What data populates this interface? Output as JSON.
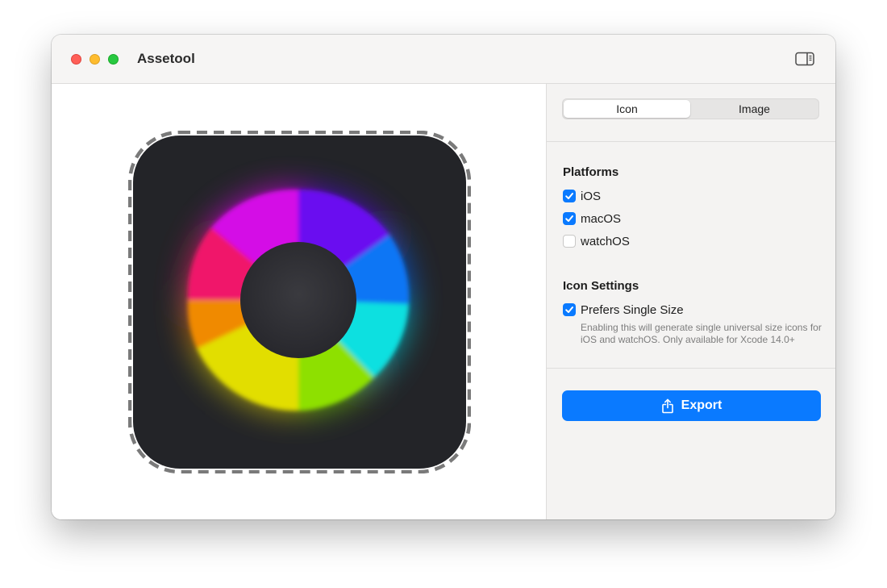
{
  "window": {
    "title": "Assetool"
  },
  "titlebar": {
    "buttons": [
      "close",
      "minimize",
      "zoom"
    ],
    "sidebar_toggle_icon": "sidebar-right-icon"
  },
  "preview": {
    "icon_description_colors": {
      "background": "#232428",
      "accent": "#0a7aff"
    }
  },
  "inspector": {
    "mode_tabs": [
      {
        "label": "Icon",
        "selected": true
      },
      {
        "label": "Image",
        "selected": false
      }
    ],
    "platforms": {
      "title": "Platforms",
      "options": [
        {
          "label": "iOS",
          "checked": true
        },
        {
          "label": "macOS",
          "checked": true
        },
        {
          "label": "watchOS",
          "checked": false
        }
      ]
    },
    "icon_settings": {
      "title": "Icon Settings",
      "prefers_single_size": {
        "label": "Prefers Single Size",
        "checked": true,
        "help": "Enabling this will generate single universal size icons for iOS and watchOS. Only available for Xcode 14.0+"
      }
    },
    "export": {
      "label": "Export",
      "icon": "share-icon"
    }
  }
}
